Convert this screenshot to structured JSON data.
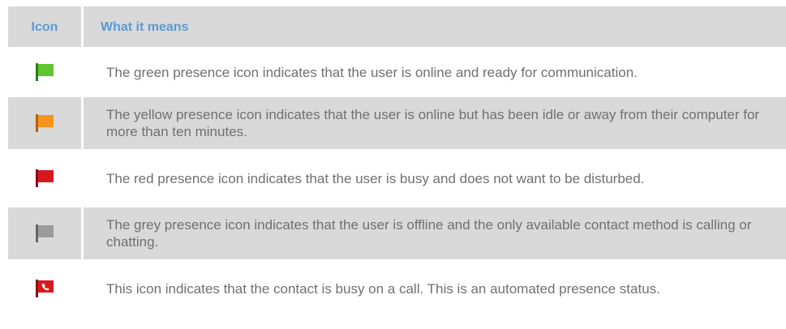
{
  "table": {
    "headers": {
      "icon": "Icon",
      "meaning": "What it means"
    },
    "rows": [
      {
        "icon_name": "green-presence-flag-icon",
        "color": "#5fc52e",
        "text": "The green presence icon indicates that the user is online and ready for communication."
      },
      {
        "icon_name": "yellow-presence-flag-icon",
        "color": "#f7941d",
        "text": "The yellow presence icon indicates that the user is online but has been idle or away from their computer for more than ten minutes."
      },
      {
        "icon_name": "red-presence-flag-icon",
        "color": "#d7191f",
        "text": "The red presence icon indicates that the user is busy and does not want to be disturbed."
      },
      {
        "icon_name": "grey-presence-flag-icon",
        "color": "#9b9b9b",
        "text": "The grey presence icon indicates that the user is offline and the only available contact method is calling or chatting."
      },
      {
        "icon_name": "on-call-presence-flag-icon",
        "color": "#d7191f",
        "text": "This icon indicates that the contact is busy on a call.  This is an automated presence status."
      }
    ]
  }
}
